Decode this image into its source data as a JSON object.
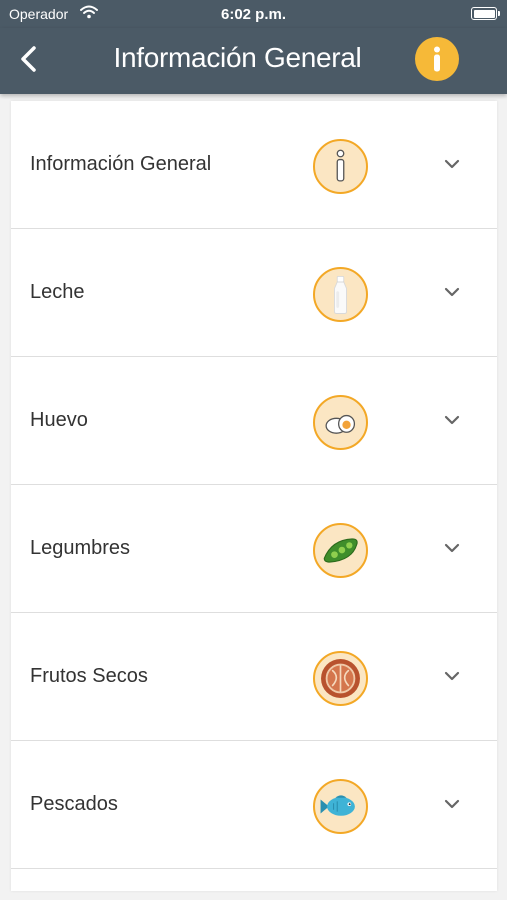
{
  "status_bar": {
    "carrier": "Operador",
    "time": "6:02 p.m."
  },
  "header": {
    "title": "Información General"
  },
  "items": [
    {
      "label": "Información General",
      "icon": "info-icon"
    },
    {
      "label": "Leche",
      "icon": "milk-bottle-icon"
    },
    {
      "label": "Huevo",
      "icon": "egg-icon"
    },
    {
      "label": "Legumbres",
      "icon": "legume-pod-icon"
    },
    {
      "label": "Frutos Secos",
      "icon": "walnut-icon"
    },
    {
      "label": "Pescados",
      "icon": "fish-icon"
    }
  ],
  "colors": {
    "header_bg": "#4b5a66",
    "accent": "#f6b938",
    "icon_bg": "#fbe6c3",
    "icon_border": "#f3a826"
  }
}
